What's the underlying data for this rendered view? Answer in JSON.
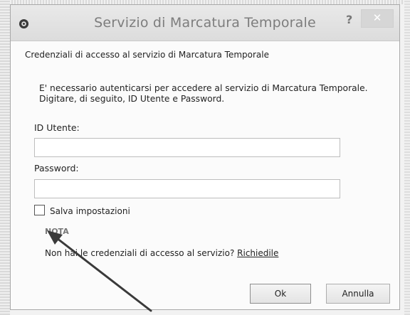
{
  "window": {
    "title": "Servizio di Marcatura Temporale",
    "help_label": "?",
    "close_label": "✕"
  },
  "content": {
    "heading": "Credenziali di accesso al servizio di Marcatura Temporale",
    "description_line1": "E' necessario autenticarsi per accedere al servizio di Marcatura Temporale.",
    "description_line2": "Digitare, di seguito, ID Utente e Password."
  },
  "form": {
    "user_label": "ID Utente:",
    "user_value": "",
    "password_label": "Password:",
    "password_value": "",
    "save_settings_label": "Salva impostazioni",
    "save_settings_checked": false
  },
  "note": {
    "label": "NOTA",
    "request_text": "Non hai le credenziali di accesso al servizio?",
    "request_link": "Richiedile"
  },
  "buttons": {
    "ok": "Ok",
    "cancel": "Annulla"
  },
  "colors": {
    "titlebar": "#e2e2e2",
    "annotation_arrow": "#3a3a3a"
  }
}
